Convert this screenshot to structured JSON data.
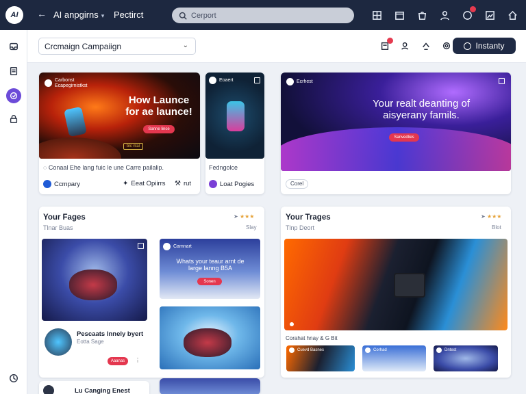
{
  "app": {
    "logo_text": "AI",
    "name": "AI anpgirns",
    "project": "Pectirct"
  },
  "search": {
    "placeholder": "Cerport"
  },
  "topbar_icons": [
    "grid-icon",
    "calendar-icon",
    "bag-icon",
    "user-icon",
    "notifications-icon",
    "media-icon",
    "home-icon"
  ],
  "toolbar": {
    "campaign_select": "Crcmaign  Campaiign",
    "primary_button": "Instanty"
  },
  "sidebar": {
    "items": [
      "inbox-icon",
      "document-icon",
      "campaign-icon",
      "lock-icon",
      "clock-icon"
    ]
  },
  "cards": {
    "launch": {
      "head_title": "Carbonst",
      "head_sub": "Ecapegirnistkst",
      "headline": "How Launce for ae launce!",
      "cta": "Sanne lince",
      "tag": "blc ntal",
      "caption": "Conaal Ehe lang fuic le une Carre pailalip.",
      "footer_left": "Ccmpary",
      "footer_mid": "Eeat Opiirrs",
      "footer_right": "rut"
    },
    "product": {
      "head_title": "Eoaert",
      "caption": "Fedngolce",
      "footer": "Loat Pogies"
    },
    "wave": {
      "head_title": "Ecrhest",
      "headline": "Your realt deanting of aisyerany famils.",
      "cta": "Sanvedlies",
      "tag": "Corel"
    },
    "pages_left": {
      "title": "Your Fages",
      "subtitle": "Tlnar Buas",
      "meta": "Slay",
      "tile_headline": "Whats your teaur arnt de large lanng B5A",
      "tile_head": "Camnart",
      "tile_cta": "Sonen",
      "item_title": "Pescaats lnnely byert",
      "item_sub": "Eotta Sage",
      "item_cta": "Aaanas",
      "bottom_item": "Lu Canging Enest"
    },
    "pages_right": {
      "title": "Your Trages",
      "subtitle": "Tlnp Deort",
      "meta": "Blot",
      "caption": "Corahat hnay & G Bit",
      "thumb_labels": [
        "Cuevd Basnes",
        "Corhad",
        "Dntest"
      ]
    }
  },
  "colors": {
    "topbar": "#1d2840",
    "accent_red": "#e4374f",
    "accent_purple": "#6c4bd8",
    "button_dark": "#1f2a44"
  }
}
